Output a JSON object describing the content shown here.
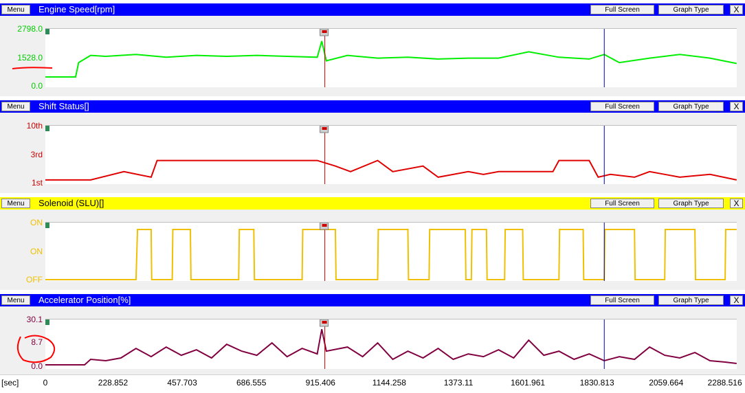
{
  "colors": {
    "header_blue": "#0000ff",
    "header_yellow": "#ffff00",
    "engine": "#00ee00",
    "shift": "#e00000",
    "solenoid": "#f0c000",
    "accel": "#800040",
    "cursor_red": "#c00000",
    "cursor_blue": "#000080",
    "annotation": "#ff0000"
  },
  "buttons": {
    "menu": "Menu",
    "full_screen": "Full Screen",
    "graph_type": "Graph Type",
    "close": "X"
  },
  "panels": [
    {
      "title": "Engine Speed[rpm]",
      "yticks": [
        "2798.0",
        "1528.0",
        "0.0"
      ],
      "header_color": "#0000ff",
      "label_color": "#00cc00"
    },
    {
      "title": "Shift Status[]",
      "yticks": [
        "10th",
        "3rd",
        "1st"
      ],
      "header_color": "#0000ff",
      "label_color": "#cc0000"
    },
    {
      "title": "Solenoid (SLU)[]",
      "yticks": [
        "ON",
        "ON",
        "OFF"
      ],
      "header_color": "#ffff00",
      "label_color": "#f0c000"
    },
    {
      "title": "Accelerator Position[%]",
      "yticks": [
        "30.1",
        "8.7",
        "0.0"
      ],
      "header_color": "#0000ff",
      "label_color": "#800040"
    }
  ],
  "x_axis": {
    "unit": "[sec]",
    "ticks": [
      "0",
      "228.852",
      "457.703",
      "686.555",
      "915.406",
      "1144.258",
      "1373.11",
      "1601.961",
      "1830.813",
      "2059.664",
      "2288.516"
    ]
  },
  "cursors": {
    "red_time": 925,
    "blue_time": 1850
  },
  "chart_data": [
    {
      "type": "line",
      "ylabel": "Engine Speed[rpm]",
      "ylim": [
        0,
        2798
      ],
      "series": [
        {
          "x": [
            0,
            100,
            110,
            150,
            200,
            300,
            400,
            500,
            600,
            700,
            800,
            900,
            915,
            930,
            1000,
            1100,
            1200,
            1300,
            1400,
            1500,
            1600,
            1700,
            1800,
            1850,
            1900,
            2000,
            2100,
            2200,
            2288
          ],
          "values": [
            500,
            500,
            1300,
            1700,
            1650,
            1750,
            1600,
            1700,
            1650,
            1700,
            1650,
            1600,
            2500,
            1400,
            1700,
            1550,
            1600,
            1500,
            1550,
            1550,
            1900,
            1600,
            1500,
            1750,
            1300,
            1550,
            1750,
            1550,
            1250
          ]
        }
      ]
    },
    {
      "type": "line",
      "ylabel": "Shift Status[]",
      "yticks": [
        "1st",
        "3rd",
        "10th"
      ],
      "ylim": [
        1,
        10
      ],
      "series": [
        {
          "x": [
            0,
            150,
            260,
            350,
            370,
            900,
            960,
            1010,
            1100,
            1150,
            1250,
            1300,
            1400,
            1450,
            1500,
            1680,
            1700,
            1800,
            1830,
            1870,
            1950,
            2000,
            2050,
            2100,
            2200,
            2288
          ],
          "values": [
            1.5,
            1.5,
            3,
            2,
            5,
            5,
            4,
            3,
            5,
            3,
            4,
            2,
            3,
            2.5,
            3,
            3,
            5,
            5,
            2,
            2.5,
            2,
            3,
            2.5,
            2,
            2.5,
            1.5
          ]
        }
      ]
    },
    {
      "type": "line",
      "ylabel": "Solenoid (SLU)[]",
      "yticks": [
        "OFF",
        "ON",
        "ON"
      ],
      "ylim": [
        0,
        1
      ],
      "series": [
        {
          "x": [
            0,
            300,
            305,
            350,
            352,
            420,
            422,
            480,
            482,
            640,
            642,
            690,
            692,
            850,
            852,
            960,
            962,
            1100,
            1102,
            1200,
            1202,
            1270,
            1272,
            1390,
            1392,
            1410,
            1412,
            1460,
            1462,
            1520,
            1522,
            1580,
            1582,
            1700,
            1702,
            1780,
            1782,
            1850,
            1852,
            1950,
            1952,
            2050,
            2052,
            2150,
            2152,
            2250,
            2252,
            2288
          ],
          "values": [
            0,
            0,
            1,
            1,
            0,
            0,
            1,
            1,
            0,
            0,
            1,
            1,
            0,
            0,
            1,
            1,
            0,
            0,
            1,
            1,
            0,
            0,
            1,
            1,
            0,
            0,
            1,
            1,
            0,
            0,
            1,
            1,
            0,
            0,
            1,
            1,
            0,
            0,
            1,
            1,
            0,
            0,
            1,
            1,
            0,
            0,
            1,
            1
          ]
        }
      ]
    },
    {
      "type": "line",
      "ylabel": "Accelerator Position[%]",
      "ylim": [
        0,
        30.1
      ],
      "series": [
        {
          "x": [
            0,
            130,
            150,
            200,
            250,
            300,
            350,
            400,
            450,
            500,
            550,
            600,
            650,
            700,
            750,
            800,
            850,
            900,
            915,
            930,
            1000,
            1050,
            1100,
            1150,
            1200,
            1250,
            1300,
            1350,
            1400,
            1450,
            1500,
            1550,
            1600,
            1650,
            1700,
            1750,
            1800,
            1850,
            1900,
            1950,
            2000,
            2050,
            2100,
            2150,
            2200,
            2250,
            2288
          ],
          "values": [
            2,
            2,
            6,
            5,
            7,
            14,
            8,
            15,
            9,
            13,
            7,
            17,
            12,
            9,
            18,
            8,
            14,
            10,
            28,
            12,
            15,
            8,
            18,
            6,
            12,
            7,
            14,
            6,
            10,
            8,
            13,
            7,
            20,
            9,
            12,
            6,
            10,
            5,
            8,
            6,
            15,
            9,
            7,
            11,
            5,
            4,
            3
          ]
        }
      ]
    }
  ]
}
